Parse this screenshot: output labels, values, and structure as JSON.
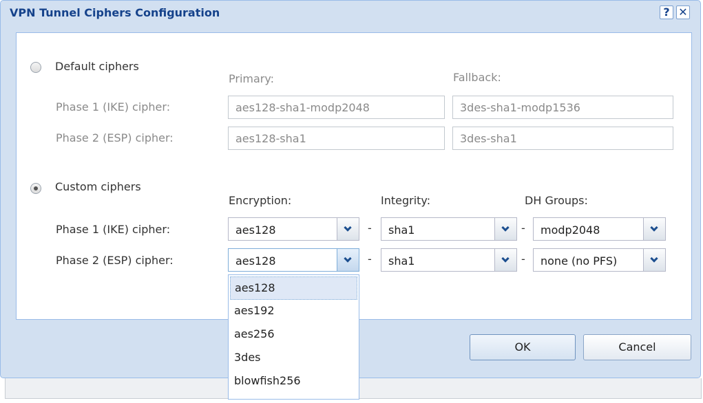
{
  "dialog": {
    "title": "VPN Tunnel Ciphers Configuration",
    "help_label": "?",
    "close_label": "✕"
  },
  "default_ciphers": {
    "radio_label": "Default ciphers",
    "selected": false,
    "col_primary": "Primary:",
    "col_fallback": "Fallback:",
    "phase1_label": "Phase 1 (IKE) cipher:",
    "phase2_label": "Phase 2 (ESP) cipher:",
    "phase1_primary": "aes128-sha1-modp2048",
    "phase1_fallback": "3des-sha1-modp1536",
    "phase2_primary": "aes128-sha1",
    "phase2_fallback": "3des-sha1"
  },
  "custom_ciphers": {
    "radio_label": "Custom ciphers",
    "selected": true,
    "col_encryption": "Encryption:",
    "col_integrity": "Integrity:",
    "col_dh": "DH Groups:",
    "phase1_label": "Phase 1 (IKE) cipher:",
    "phase2_label": "Phase 2 (ESP) cipher:",
    "separator": "-",
    "phase1": {
      "encryption": "aes128",
      "integrity": "sha1",
      "dh": "modp2048"
    },
    "phase2": {
      "encryption": "aes128",
      "integrity": "sha1",
      "dh": "none (no PFS)"
    }
  },
  "encryption_dropdown": {
    "options": [
      "aes128",
      "aes192",
      "aes256",
      "3des",
      "blowfish256"
    ],
    "selected": "aes128"
  },
  "buttons": {
    "ok": "OK",
    "cancel": "Cancel"
  },
  "colors": {
    "title": "#15428b",
    "frame": "#d2e0f1",
    "border": "#99bbe8",
    "selection": "#dfe8f6"
  }
}
